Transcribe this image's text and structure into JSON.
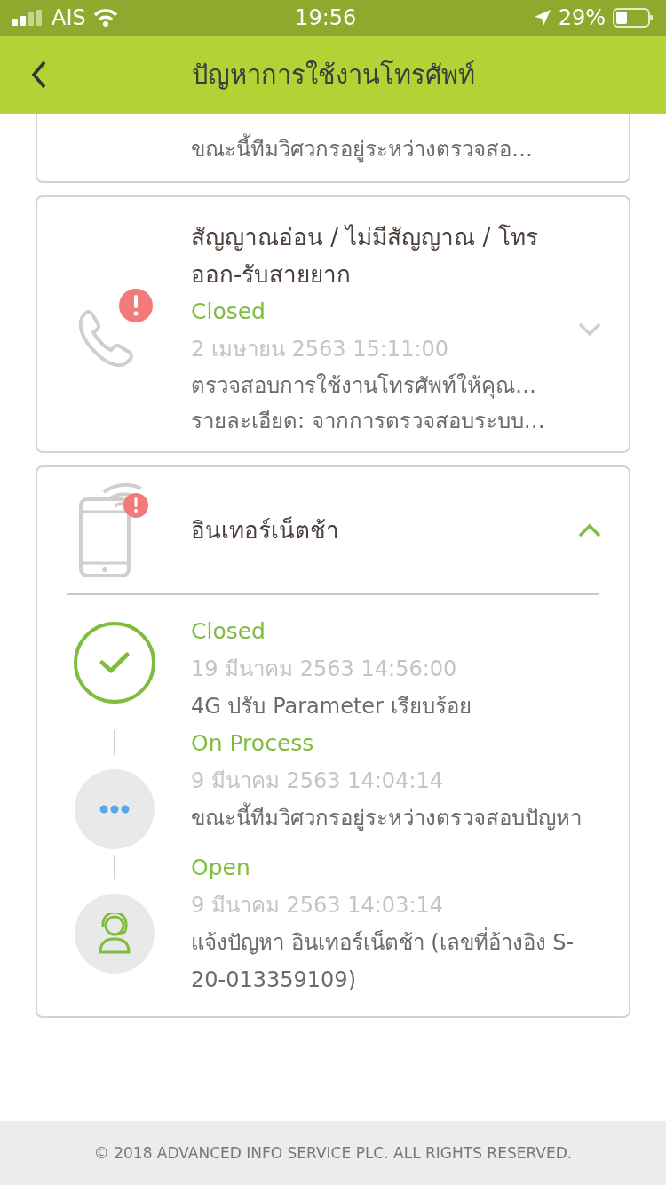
{
  "status_bar": {
    "carrier": "AIS",
    "time": "19:56",
    "battery": "29%"
  },
  "header": {
    "title": "ปัญหาการใช้งานโทรศัพท์"
  },
  "cut_off_ticket": {
    "summary": "ขณะนี้ทีมวิศวกรอยู่ระหว่างตรวจสอ…"
  },
  "tickets": [
    {
      "kind": "phone",
      "title": "สัญญาณอ่อน / ไม่มีสัญญาณ / โทรออก-รับสายยาก",
      "status": "Closed",
      "date": "2 เมษายน 2563 15:11:00",
      "summary": [
        "ตรวจสอบการใช้งานโทรศัพท์ให้คุณ…",
        "รายละเอียด: จากการตรวจสอบระบบ…"
      ],
      "expanded": false
    },
    {
      "kind": "mobile",
      "title": "อินเทอร์เน็ตช้า",
      "expanded": true,
      "events": [
        {
          "kind": "done",
          "status": "Closed",
          "date": "19 มีนาคม 2563 14:56:00",
          "text": "4G ปรับ Parameter เรียบร้อย"
        },
        {
          "kind": "process",
          "status": "On Process",
          "date": "9 มีนาคม 2563 14:04:14",
          "text": "ขณะนี้ทีมวิศวกรอยู่ระหว่างตรวจสอบปัญหา"
        },
        {
          "kind": "open",
          "status": "Open",
          "date": "9 มีนาคม 2563 14:03:14",
          "text": "แจ้งปัญหา อินเทอร์เน็ตช้า (เลขที่อ้างอิง S-20-013359109)"
        }
      ]
    }
  ],
  "footer": {
    "copyright": "© 2018 ADVANCED INFO SERVICE PLC. ALL RIGHTS RESERVED."
  }
}
